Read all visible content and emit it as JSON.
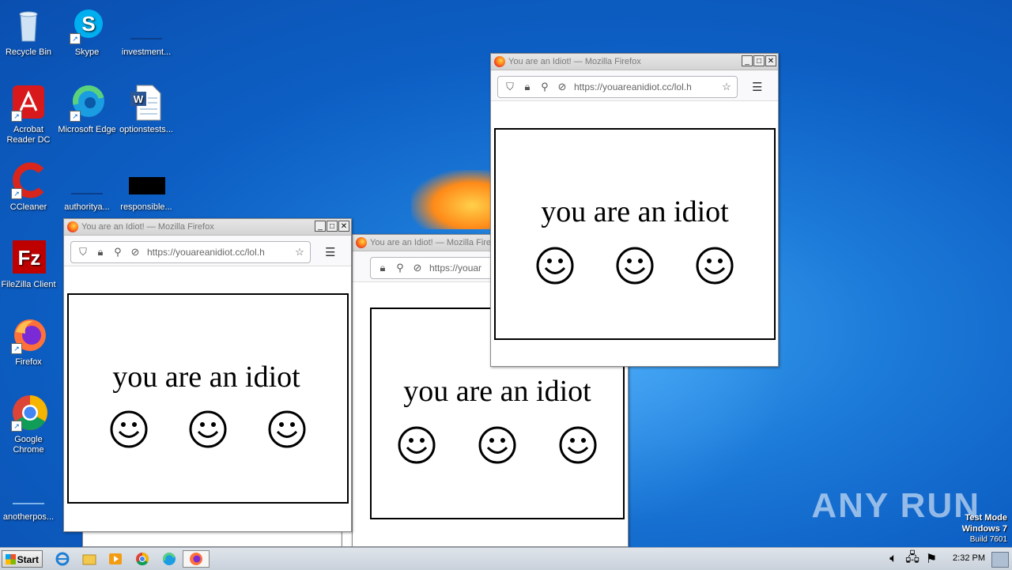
{
  "desktop": {
    "icons": [
      {
        "name": "recycle-bin",
        "label": "Recycle Bin"
      },
      {
        "name": "skype",
        "label": "Skype"
      },
      {
        "name": "investment",
        "label": "investment..."
      },
      {
        "name": "acrobat",
        "label": "Acrobat Reader DC"
      },
      {
        "name": "edge",
        "label": "Microsoft Edge"
      },
      {
        "name": "optionstests",
        "label": "optionstests..."
      },
      {
        "name": "ccleaner",
        "label": "CCleaner"
      },
      {
        "name": "authority",
        "label": "authorityа..."
      },
      {
        "name": "responsible",
        "label": "responsible..."
      },
      {
        "name": "filezilla",
        "label": "FileZilla Client"
      },
      {
        "name": "firefox",
        "label": "Firefox"
      },
      {
        "name": "chrome",
        "label": "Google Chrome"
      },
      {
        "name": "anotherpos",
        "label": "anotherpos..."
      }
    ]
  },
  "windows": [
    {
      "title": "You are an Idiot! — Mozilla Firefox",
      "url": "https://youareanidiot.cc/lol.h",
      "message": "you are an idiot"
    },
    {
      "title": "You are an Idiot! — Mozilla Firefox",
      "url": "https://youar",
      "message": "you are an idiot"
    },
    {
      "title": "You are an Idiot! — Mozilla Firefox",
      "url": "https://youareanidiot.cc/lol.h",
      "message": "you are an idiot"
    }
  ],
  "taskbar": {
    "start_label": "Start",
    "clock": "2:32 PM"
  },
  "watermark": {
    "brand": "ANY RUN",
    "test_mode": "Test Mode",
    "os": "Windows 7",
    "build": "Build 7601"
  },
  "colors": {
    "desktop": "#0d5fc4",
    "frame_border": "#000000"
  }
}
